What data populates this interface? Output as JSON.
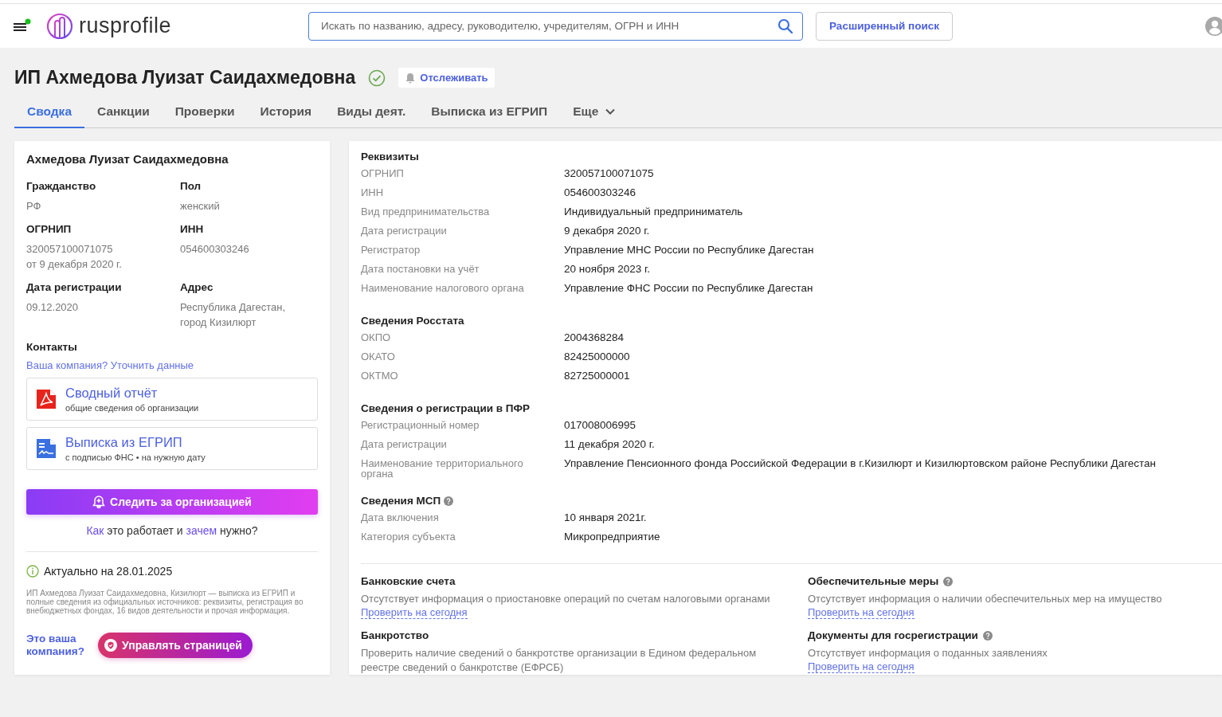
{
  "header": {
    "notification": true,
    "logo_text": "rusprofile",
    "search": {
      "placeholder": "Искать по названию, адресу, руководителю, учредителям, ОГРН и ИНН"
    },
    "advanced_search_button": "Расширенный поиск"
  },
  "page": {
    "title": "ИП Ахмедова Луизат Саидахмедовна",
    "verified": true,
    "watch_button": "Отслеживать"
  },
  "tabs": [
    {
      "label": "Сводка",
      "selected": true,
      "kind": "tab"
    },
    {
      "label": "Санкции",
      "selected": false,
      "kind": "tab"
    },
    {
      "label": "Проверки",
      "selected": false,
      "kind": "tab"
    },
    {
      "label": "История",
      "selected": false,
      "kind": "tab"
    },
    {
      "label": "Виды деят.",
      "selected": false,
      "kind": "tab"
    },
    {
      "label": "Выписка из ЕГРИП",
      "selected": false,
      "kind": "tab"
    },
    {
      "label": "Еще",
      "selected": false,
      "kind": "dropdown"
    }
  ],
  "summary_card": {
    "person_name": "Ахмедова Луизат Саидахмедовна",
    "fields": [
      {
        "label": "Гражданство",
        "values": [
          "РФ"
        ]
      },
      {
        "label": "Пол",
        "values": [
          "женский"
        ]
      },
      {
        "label": "ОГРНИП",
        "values": [
          "320057100071075",
          "от 9 декабря 2020 г."
        ]
      },
      {
        "label": "ИНН",
        "values": [
          "054600303246"
        ]
      },
      {
        "label": "Дата регистрации",
        "values": [
          "09.12.2020"
        ]
      },
      {
        "label": "Адрес",
        "values": [
          "Республика Дагестан, город Кизилюрт"
        ]
      }
    ],
    "contacts_label": "Контакты",
    "contacts_link": "Ваша компания? Уточнить данные",
    "documents": [
      {
        "kind": "pdf",
        "title": "Сводный отчёт",
        "subtitle": "общие сведения об организации"
      },
      {
        "kind": "extract",
        "title": "Выписка из ЕГРИП",
        "subtitle": "с подписью ФНС • на нужную дату"
      }
    ],
    "follow_button": "Следить за организацией",
    "how_it_works": [
      {
        "text": "Как",
        "link": true
      },
      {
        "text": "это работает и",
        "link": false
      },
      {
        "text": "зачем",
        "link": true
      },
      {
        "text": "нужно?",
        "link": false
      }
    ],
    "actual_date": "Актуально на 28.01.2025",
    "description": "ИП Ахмедова Луизат Саидахмедовна, Кизилюрт — выписка из ЕГРИП и полные сведения из официальных источников: реквизиты, регистрация во внебюджетных фондах, 16 видов деятельности и прочая информация.",
    "claim_label": "Это ваша компания?",
    "manage_button": "Управлять страницей"
  },
  "details": [
    {
      "title": "Реквизиты",
      "help": false,
      "rows": [
        {
          "label": "ОГРНИП",
          "value": "320057100071075"
        },
        {
          "label": "ИНН",
          "value": "054600303246"
        },
        {
          "label": "Вид предпринимательства",
          "value": "Индивидуальный предприниматель"
        },
        {
          "label": "Дата регистрации",
          "value": "9 декабря 2020 г."
        },
        {
          "label": "Регистратор",
          "value": "Управление МНС России по Республике Дагестан"
        },
        {
          "label": "Дата постановки на учёт",
          "value": "20 ноября 2023 г."
        },
        {
          "label": "Наименование налогового органа",
          "value": "Управление ФНС России по Республике Дагестан"
        }
      ]
    },
    {
      "title": "Сведения Росстата",
      "help": false,
      "rows": [
        {
          "label": "ОКПО",
          "value": "2004368284"
        },
        {
          "label": "ОКАТО",
          "value": "82425000000"
        },
        {
          "label": "ОКТМО",
          "value": "82725000001"
        }
      ]
    },
    {
      "title": "Сведения о регистрации в ПФР",
      "help": false,
      "rows": [
        {
          "label": "Регистрационный номер",
          "value": "017008006995"
        },
        {
          "label": "Дата регистрации",
          "value": "11 декабря 2020 г."
        },
        {
          "label": "Наименование территориального органа",
          "value": "Управление Пенсионного фонда Российской Федерации в г.Кизилюрт и Кизилюртовском районе Республики Дагестан"
        }
      ]
    },
    {
      "title": "Сведения МСП",
      "help": true,
      "rows": [
        {
          "label": "Дата включения",
          "value": "10 января 2021г."
        },
        {
          "label": "Категория субъекта",
          "value": "Микропредприятие"
        }
      ]
    }
  ],
  "checks": [
    {
      "title": "Банковские счета",
      "help": false,
      "text": "Отсутствует информация о приостановке операций по счетам налоговыми органами",
      "link": "Проверить на сегодня"
    },
    {
      "title": "Обеспечительные меры",
      "help": true,
      "text": "Отсутствует информация о наличии обеспечительных мер на имущество",
      "link": "Проверить на сегодня"
    },
    {
      "title": "Банкротство",
      "help": false,
      "text": "Проверить наличие сведений о банкротстве организации в Едином федеральном реестре сведений о банкротстве (ЕФРСБ)"
    },
    {
      "title": "Документы для госрегистрации",
      "help": true,
      "text": "Отсутствует информация о поданных заявлениях",
      "link": "Проверить на сегодня"
    }
  ]
}
